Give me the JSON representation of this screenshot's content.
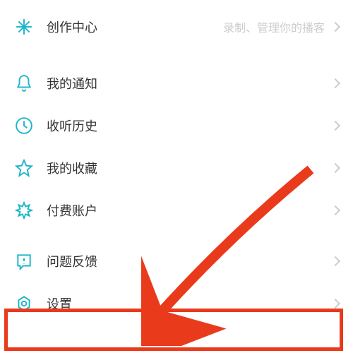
{
  "menu": {
    "create": {
      "label": "创作中心",
      "hint": "录制、管理你的播客"
    },
    "notifications": {
      "label": "我的通知"
    },
    "history": {
      "label": "收听历史"
    },
    "favorites": {
      "label": "我的收藏"
    },
    "paid": {
      "label": "付费账户"
    },
    "feedback": {
      "label": "问题反馈"
    },
    "settings": {
      "label": "设置"
    }
  },
  "colors": {
    "accent": "#1fb5c9",
    "highlight": "#e93a1c"
  }
}
